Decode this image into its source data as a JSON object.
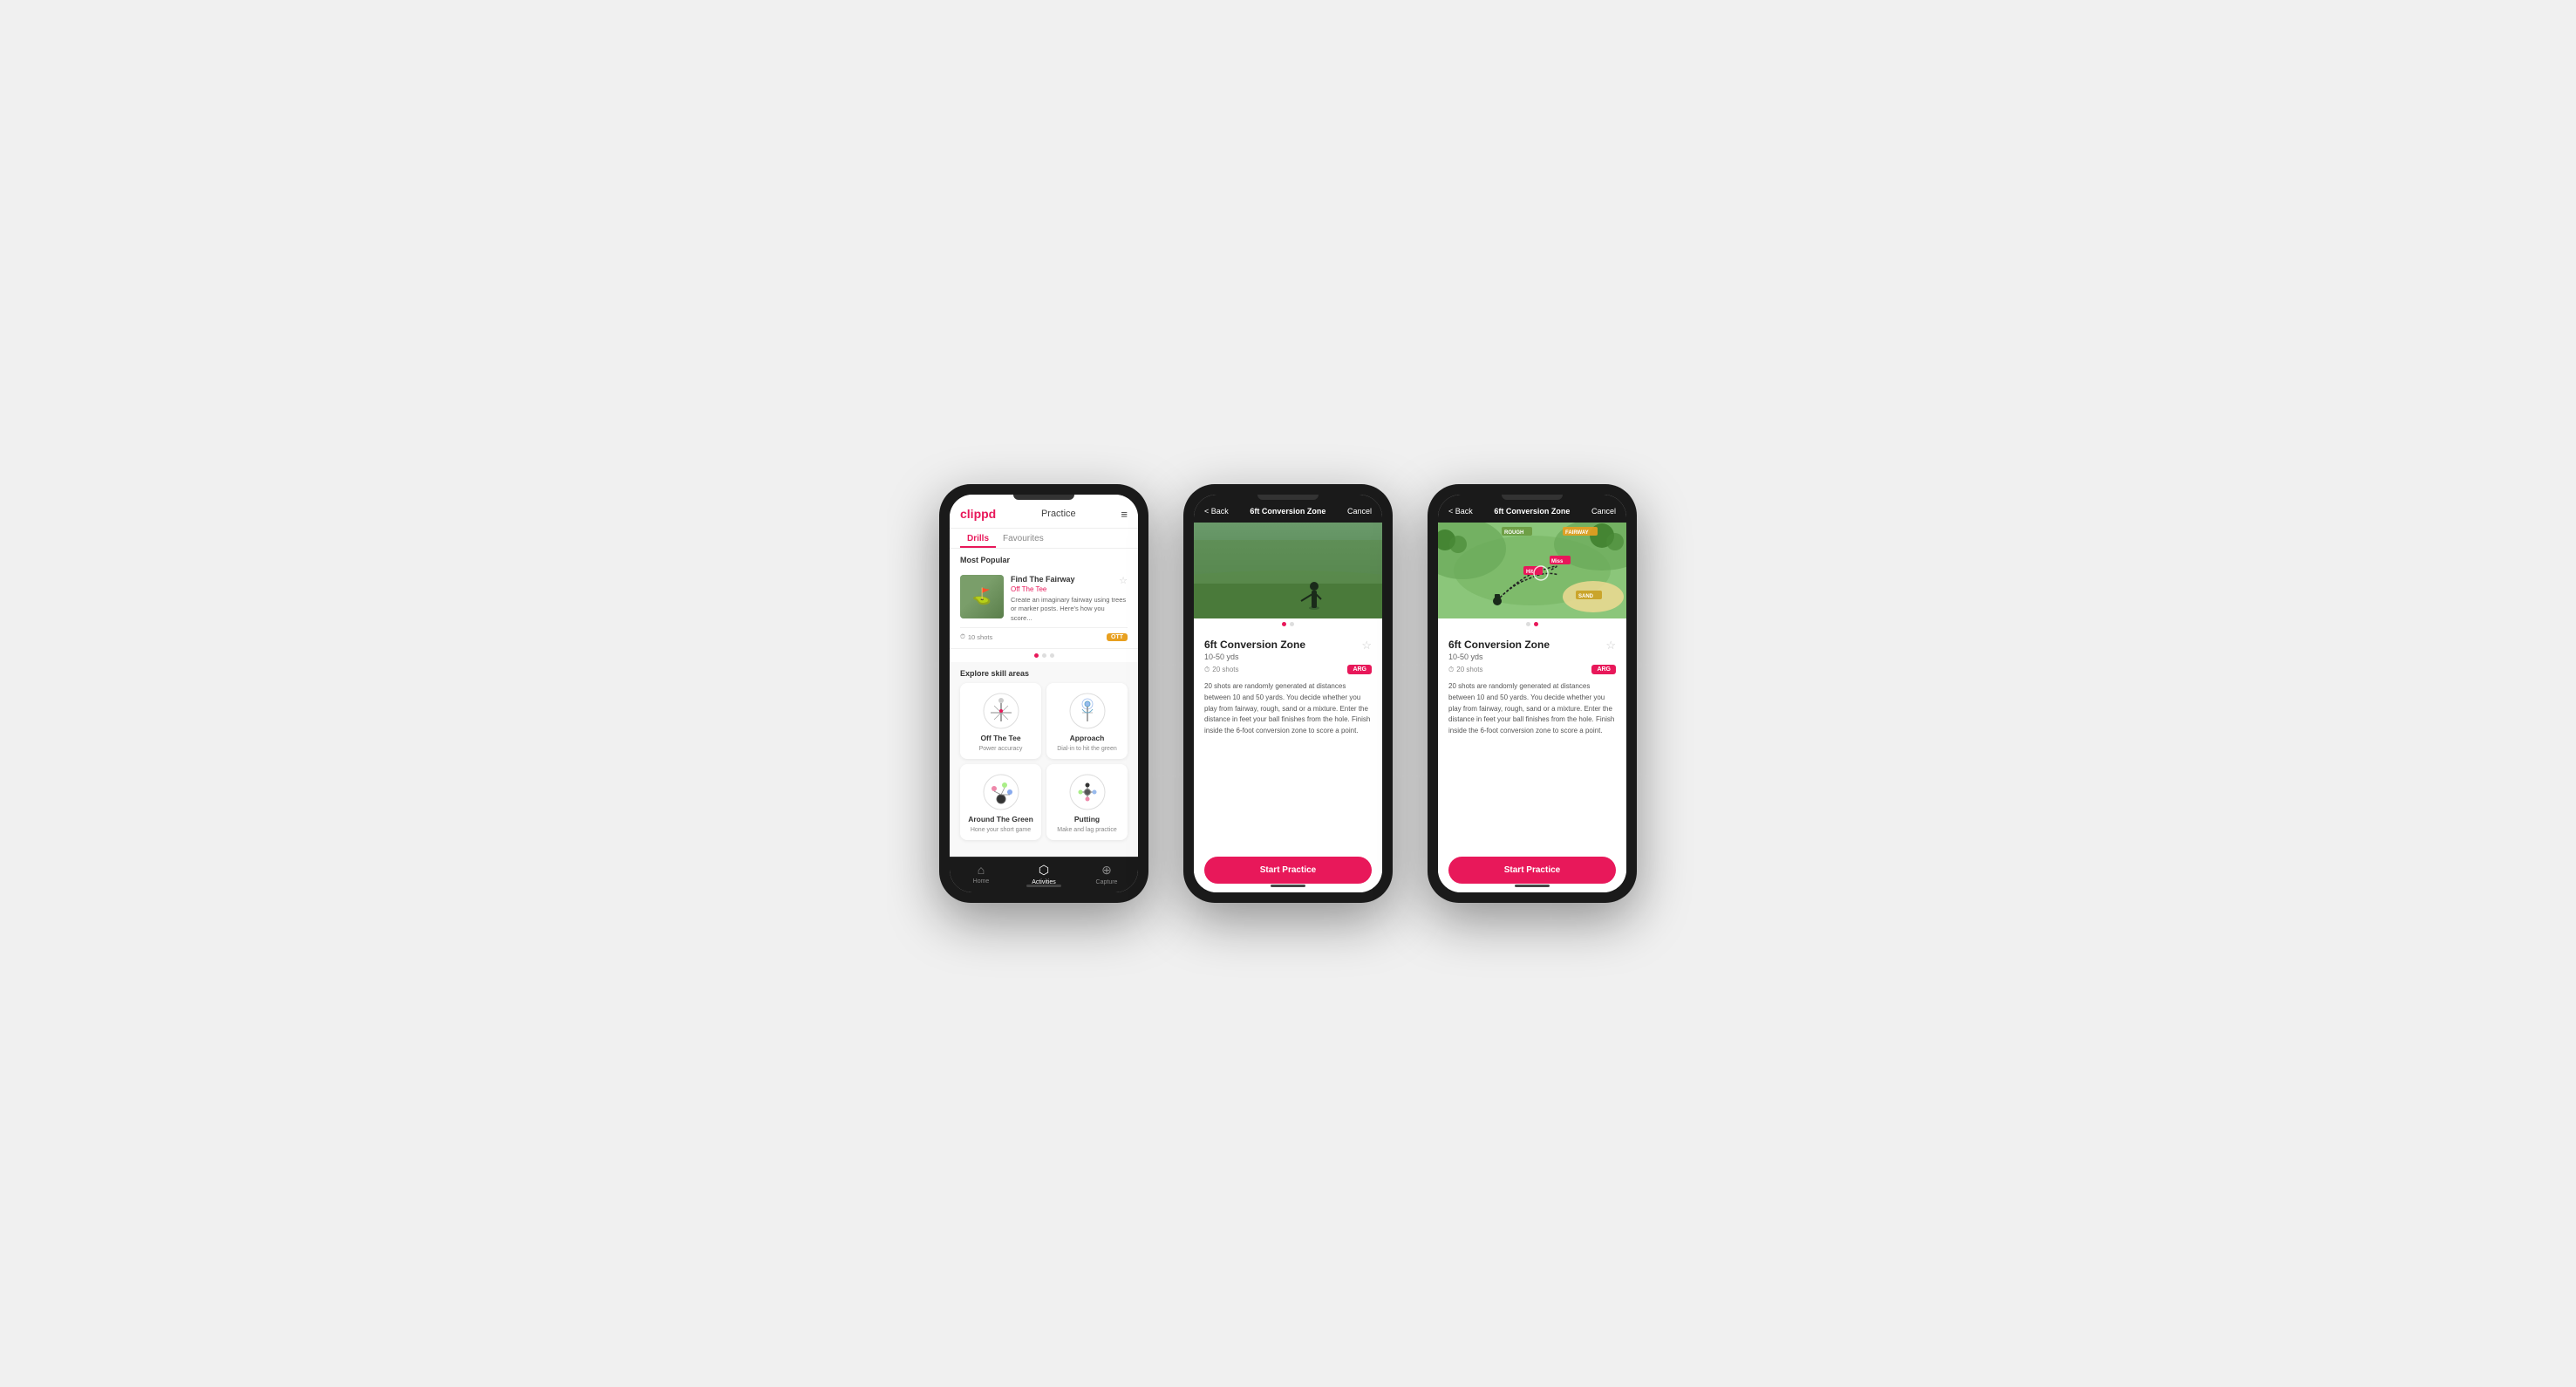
{
  "phones": [
    {
      "id": "phone1",
      "header": {
        "logo": "clippd",
        "title": "Practice",
        "menu_icon": "≡"
      },
      "tabs": [
        {
          "label": "Drills",
          "active": true
        },
        {
          "label": "Favourites",
          "active": false
        }
      ],
      "most_popular_label": "Most Popular",
      "featured_drill": {
        "name": "Find The Fairway",
        "subtitle": "Off The Tee",
        "description": "Create an imaginary fairway using trees or marker posts. Here's how you score...",
        "shots": "10 shots",
        "tag": "OTT"
      },
      "explore_label": "Explore skill areas",
      "skills": [
        {
          "name": "Off The Tee",
          "desc": "Power accuracy"
        },
        {
          "name": "Approach",
          "desc": "Dial-in to hit the green"
        },
        {
          "name": "Around The Green",
          "desc": "Hone your short game"
        },
        {
          "name": "Putting",
          "desc": "Make and lag practice"
        }
      ],
      "nav": [
        {
          "label": "Home",
          "icon": "⌂",
          "active": false
        },
        {
          "label": "Activities",
          "icon": "♦",
          "active": true
        },
        {
          "label": "Capture",
          "icon": "⊕",
          "active": false
        }
      ]
    },
    {
      "id": "phone2",
      "header": {
        "back": "< Back",
        "title": "6ft Conversion Zone",
        "cancel": "Cancel"
      },
      "drill": {
        "name": "6ft Conversion Zone",
        "distance": "10-50 yds",
        "shots": "20 shots",
        "tag": "ARG",
        "description": "20 shots are randomly generated at distances between 10 and 50 yards. You decide whether you play from fairway, rough, sand or a mixture. Enter the distance in feet your ball finishes from the hole. Finish inside the 6-foot conversion zone to score a point.",
        "start_label": "Start Practice"
      }
    },
    {
      "id": "phone3",
      "header": {
        "back": "< Back",
        "title": "6ft Conversion Zone",
        "cancel": "Cancel"
      },
      "drill": {
        "name": "6ft Conversion Zone",
        "distance": "10-50 yds",
        "shots": "20 shots",
        "tag": "ARG",
        "description": "20 shots are randomly generated at distances between 10 and 50 yards. You decide whether you play from fairway, rough, sand or a mixture. Enter the distance in feet your ball finishes from the hole. Finish inside the 6-foot conversion zone to score a point.",
        "start_label": "Start Practice"
      }
    }
  ]
}
